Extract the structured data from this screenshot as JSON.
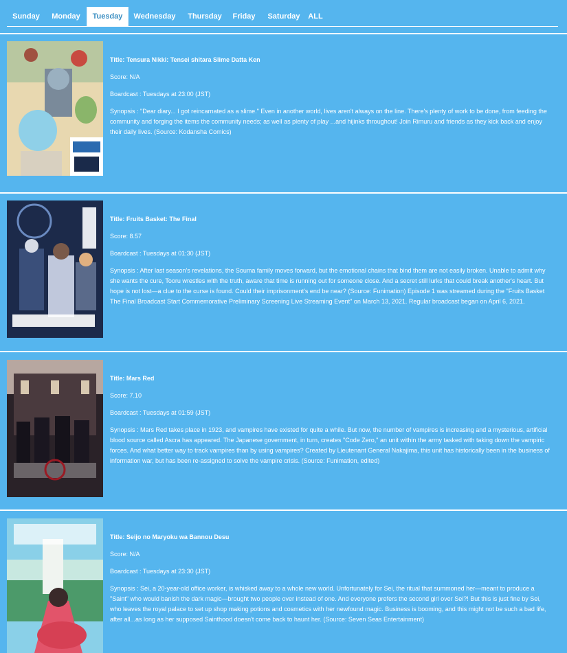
{
  "tabs": [
    {
      "label": "Sunday",
      "active": false
    },
    {
      "label": "Monday",
      "active": false
    },
    {
      "label": "Tuesday",
      "active": true
    },
    {
      "label": "Wednesday",
      "active": false
    },
    {
      "label": "Thursday",
      "active": false
    },
    {
      "label": "Friday",
      "active": false
    },
    {
      "label": "Saturday",
      "active": false
    },
    {
      "label": "ALL",
      "active": false
    }
  ],
  "labels": {
    "title": "Title: ",
    "score": "Score: ",
    "boardcast": "Boardcast : ",
    "synopsis": "Synopsis : "
  },
  "anime": [
    {
      "title": "Tensura Nikki: Tensei shitara Slime Datta Ken",
      "score": "N/A",
      "boardcast": "Tuesdays at 23:00 (JST)",
      "synopsis": "\"Dear diary... I got reincarnated as a slime.\" Even in another world, lives aren't always on the line. There's plenty of work to be done, from feeding the community and forging the items the community needs; as well as plenty of play ...and hijinks throughout! Join Rimuru and friends as they kick back and enjoy their daily lives. (Source: Kodansha Comics)",
      "poster_palette": [
        "#e8d8b0",
        "#6a8a9a",
        "#c9c0a8"
      ]
    },
    {
      "title": "Fruits Basket: The Final",
      "score": "8.57",
      "boardcast": "Tuesdays at 01:30 (JST)",
      "synopsis": "After last season's revelations, the Souma family moves forward, but the emotional chains that bind them are not easily broken. Unable to admit why she wants the cure, Tooru wrestles with the truth, aware that time is running out for someone close. And a secret still lurks that could break another's heart. But hope is not lost—a clue to the curse is found. Could their imprisonment's end be near? (Source: Funimation) Episode 1 was streamed during the \"Fruits Basket The Final Broadcast Start Commemorative Preliminary Screening Live Streaming Event\" on March 13, 2021. Regular broadcast began on April 6, 2021.",
      "poster_palette": [
        "#1c2a4a",
        "#3a4f7a",
        "#d8dce6"
      ]
    },
    {
      "title": "Mars Red",
      "score": "7.10",
      "boardcast": "Tuesdays at 01:59 (JST)",
      "synopsis": "Mars Red takes place in 1923, and vampires have existed for quite a while. But now, the number of vampires is increasing and a mysterious, artificial blood source called Ascra has appeared. The Japanese government, in turn, creates \"Code Zero,\" an unit within the army tasked with taking down the vampiric forces. And what better way to track vampires than by using vampires? Created by Lieutenant General Nakajima, this unit has historically been in the business of information war, but has been re-assigned to solve the vampire crisis. (Source: Funimation, edited)",
      "poster_palette": [
        "#5a4a4a",
        "#2a2228",
        "#b7a7a0"
      ]
    },
    {
      "title": "Seijo no Maryoku wa Bannou Desu",
      "score": "N/A",
      "boardcast": "Tuesdays at 23:30 (JST)",
      "synopsis": "Sei, a 20-year-old office worker, is whisked away to a whole new world. Unfortunately for Sei, the ritual that summoned her—meant to produce a \"Saint\" who would banish the dark magic—brought two people over instead of one. And everyone prefers the second girl over Sei?! But this is just fine by Sei, who leaves the royal palace to set up shop making potions and cosmetics with her newfound magic. Business is booming, and this might not be such a bad life, after all...as long as her supposed Sainthood doesn't come back to haunt her. (Source: Seven Seas Entertainment)",
      "poster_palette": [
        "#8ad0e8",
        "#4c9a6a",
        "#e2546a"
      ]
    }
  ]
}
